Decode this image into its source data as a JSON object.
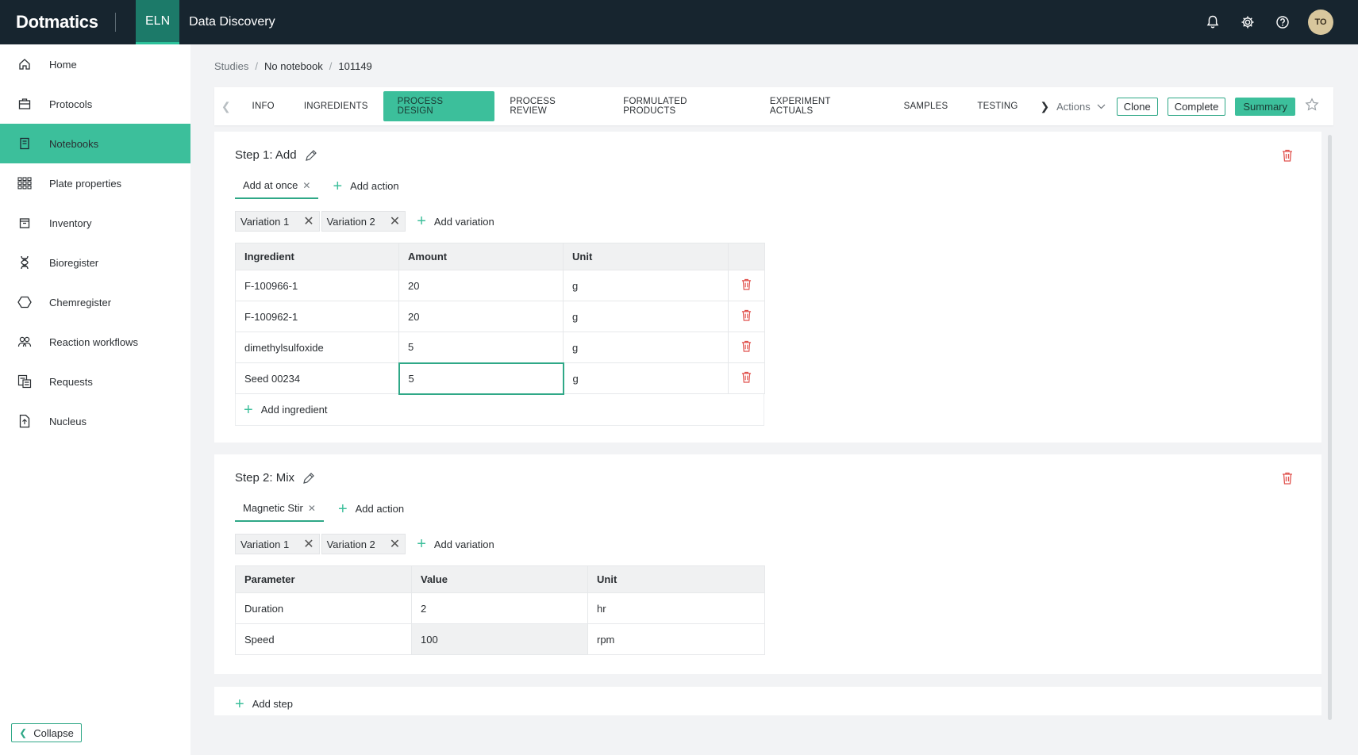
{
  "app": {
    "brand": "Dotmatics",
    "nav": [
      {
        "label": "ELN",
        "active": true
      },
      {
        "label": "Data Discovery",
        "active": false
      }
    ],
    "avatar_initials": "TO",
    "accent_color": "#3cbf9b",
    "topbar_color": "#17252f"
  },
  "sidebar": {
    "items": [
      {
        "label": "Home",
        "icon": "home-icon"
      },
      {
        "label": "Protocols",
        "icon": "briefcase-icon"
      },
      {
        "label": "Notebooks",
        "icon": "notebook-icon",
        "active": true
      },
      {
        "label": "Plate properties",
        "icon": "grid-icon"
      },
      {
        "label": "Inventory",
        "icon": "box-icon"
      },
      {
        "label": "Bioregister",
        "icon": "dna-icon"
      },
      {
        "label": "Chemregister",
        "icon": "hexagon-icon"
      },
      {
        "label": "Reaction workflows",
        "icon": "users-icon"
      },
      {
        "label": "Requests",
        "icon": "requests-icon"
      },
      {
        "label": "Nucleus",
        "icon": "document-icon"
      }
    ],
    "collapse_label": "Collapse"
  },
  "breadcrumb": [
    "Studies",
    "No notebook",
    "101149"
  ],
  "tabs": [
    {
      "label": "INFO"
    },
    {
      "label": "INGREDIENTS"
    },
    {
      "label": "PROCESS DESIGN",
      "active": true
    },
    {
      "label": "PROCESS REVIEW"
    },
    {
      "label": "FORMULATED PRODUCTS"
    },
    {
      "label": "EXPERIMENT ACTUALS"
    },
    {
      "label": "SAMPLES"
    },
    {
      "label": "TESTING"
    }
  ],
  "tab_actions": {
    "actions_label": "Actions",
    "clone_label": "Clone",
    "complete_label": "Complete",
    "summary_label": "Summary"
  },
  "step1": {
    "title": "Step 1: Add",
    "action_tab": "Add at once",
    "add_action_label": "Add action",
    "variations": [
      "Variation 1",
      "Variation 2"
    ],
    "add_variation_label": "Add variation",
    "columns": [
      "Ingredient",
      "Amount",
      "Unit"
    ],
    "rows": [
      {
        "ingredient": "F-100966-1",
        "amount": "20",
        "unit": "g"
      },
      {
        "ingredient": "F-100962-1",
        "amount": "20",
        "unit": "g"
      },
      {
        "ingredient": "dimethylsulfoxide",
        "amount": "5",
        "unit": "g"
      },
      {
        "ingredient": "Seed 00234",
        "amount": "5",
        "unit": "g"
      }
    ],
    "add_ingredient_label": "Add ingredient"
  },
  "step2": {
    "title": "Step 2: Mix",
    "action_tab": "Magnetic Stir",
    "add_action_label": "Add action",
    "variations": [
      "Variation 1",
      "Variation 2"
    ],
    "add_variation_label": "Add variation",
    "columns": [
      "Parameter",
      "Value",
      "Unit"
    ],
    "rows": [
      {
        "parameter": "Duration",
        "value": "2",
        "unit": "hr"
      },
      {
        "parameter": "Speed",
        "value": "100",
        "unit": "rpm"
      }
    ]
  },
  "add_step_label": "Add step"
}
